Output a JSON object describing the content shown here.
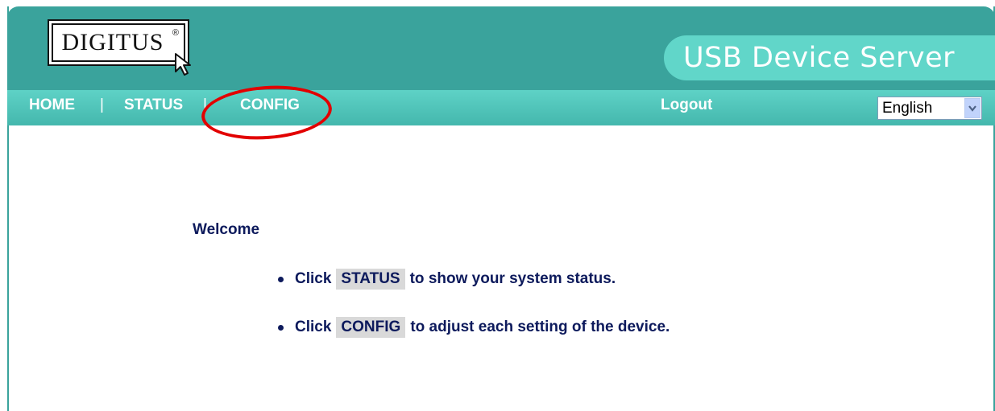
{
  "logo": {
    "brand": "DIGITUS",
    "registered": "®"
  },
  "header": {
    "title": "USB Device Server"
  },
  "nav": {
    "items": [
      {
        "label": "HOME"
      },
      {
        "label": "STATUS"
      },
      {
        "label": "CONFIG"
      }
    ],
    "separator": "|",
    "logout": "Logout",
    "language": {
      "selected": "English"
    }
  },
  "content": {
    "welcome": "Welcome",
    "bullets": [
      {
        "prefix": "Click",
        "keyword": "STATUS",
        "suffix": "to show your system status."
      },
      {
        "prefix": "Click",
        "keyword": "CONFIG",
        "suffix": "to adjust each setting of the device."
      }
    ]
  },
  "colors": {
    "header_bg": "#3aa39c",
    "nav_bg": "#4fc4b9",
    "title_pill": "#61d6c9",
    "text_dark_blue": "#0d1a5c",
    "highlight_annotation": "#e20000"
  }
}
